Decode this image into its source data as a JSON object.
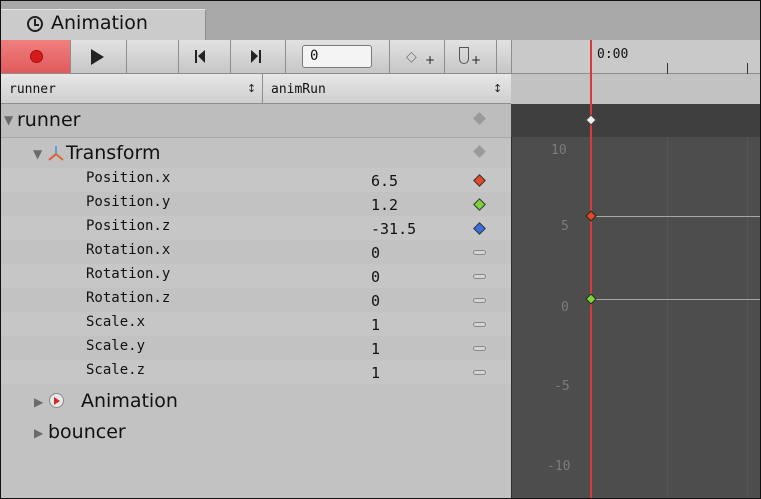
{
  "tab": {
    "title": "Animation"
  },
  "toolbar": {
    "frame_value": "0"
  },
  "timeline": {
    "time_label": "0:00"
  },
  "selectors": {
    "object": "runner",
    "clip": "animRun",
    "arrow": "↕"
  },
  "tree": {
    "root_label": "runner",
    "transform_label": "Transform",
    "animation_label": "Animation",
    "bouncer_label": "bouncer",
    "properties": [
      {
        "name": "Position.x",
        "value": "6.5",
        "key_color": "#e04a2a"
      },
      {
        "name": "Position.y",
        "value": "1.2",
        "key_color": "#7ed33a"
      },
      {
        "name": "Position.z",
        "value": "-31.5",
        "key_color": "#3a6fe0"
      },
      {
        "name": "Rotation.x",
        "value": "0"
      },
      {
        "name": "Rotation.y",
        "value": "0"
      },
      {
        "name": "Rotation.z",
        "value": "0"
      },
      {
        "name": "Scale.x",
        "value": "1"
      },
      {
        "name": "Scale.y",
        "value": "1"
      },
      {
        "name": "Scale.z",
        "value": "1"
      }
    ]
  },
  "curve_axis": {
    "labels": [
      "10",
      "5",
      "0",
      "-5",
      "-10"
    ]
  },
  "colors": {
    "record": "#d91a1a",
    "playhead": "#d73a3a",
    "curve_bg": "#4d4d4d"
  },
  "icons": [
    "clock-icon",
    "record-icon",
    "play-icon",
    "prev-keyframe-icon",
    "next-keyframe-icon",
    "add-keyframe-icon",
    "add-event-icon"
  ]
}
